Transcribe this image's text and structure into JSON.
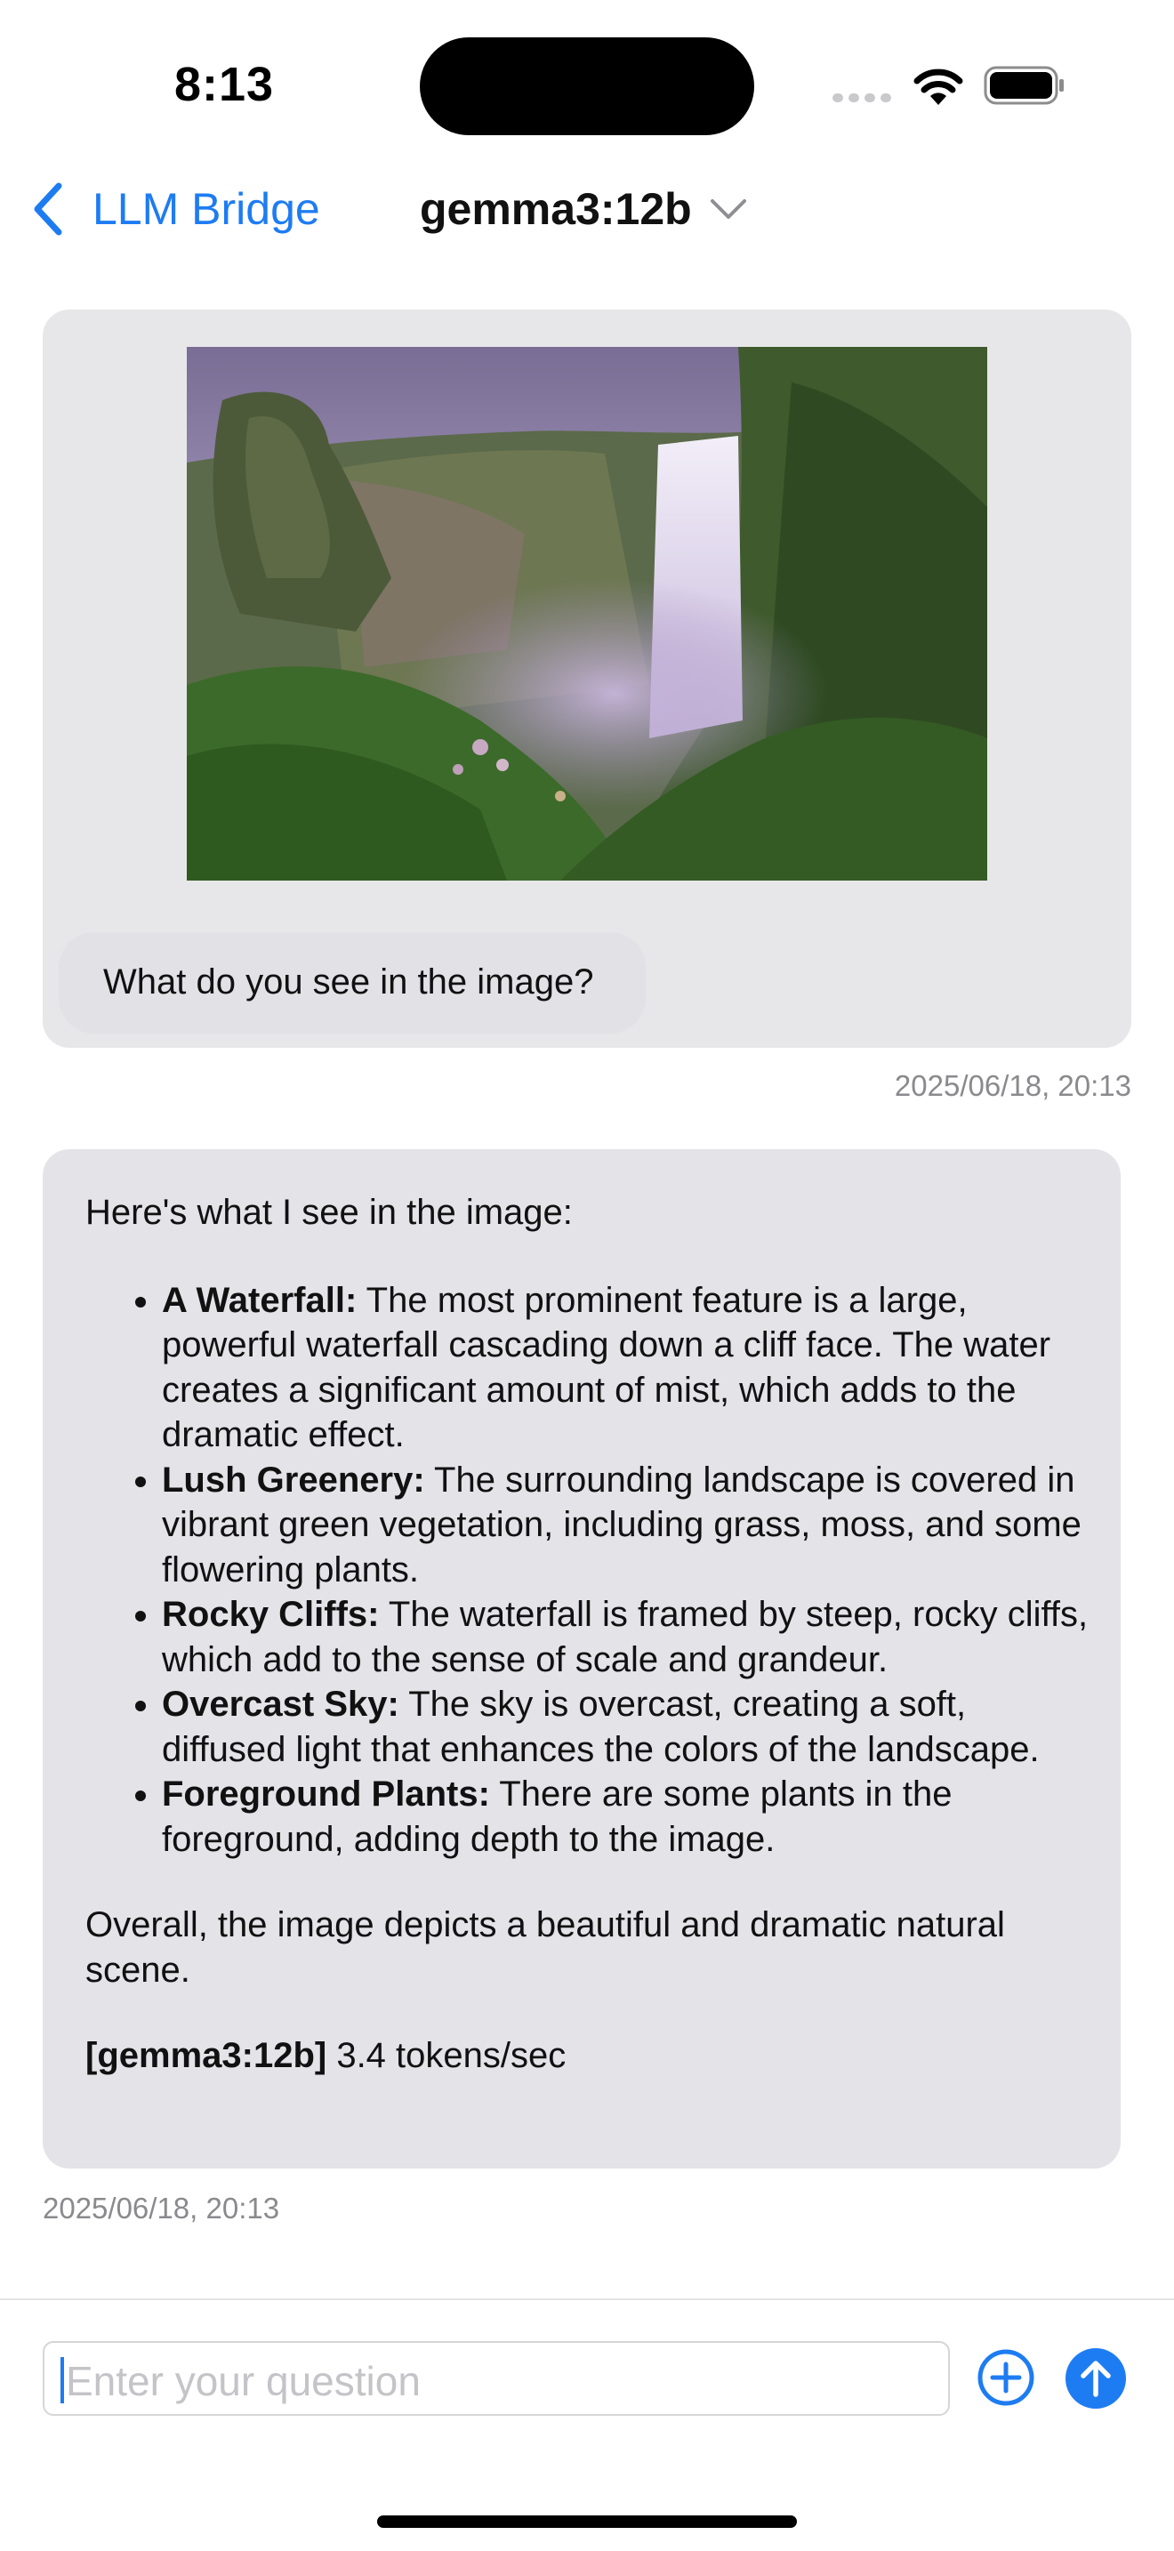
{
  "status_bar": {
    "time": "8:13"
  },
  "nav": {
    "back_label": "LLM Bridge",
    "model_title": "gemma3:12b",
    "back_icon": "chevron-left-icon",
    "model_menu_icon": "chevron-down-icon"
  },
  "conversation": {
    "user_message": {
      "image": "waterfall landscape photo",
      "text": "What do you see in the image?",
      "timestamp": "2025/06/18, 20:13"
    },
    "assistant_message": {
      "intro": "Here's what I see in the image:",
      "bullets": [
        {
          "title": "A Waterfall:",
          "text": " The most prominent feature is a large, powerful waterfall cascading down a cliff face. The water creates a significant amount of mist, which adds to the dramatic effect."
        },
        {
          "title": "Lush Greenery:",
          "text": " The surrounding landscape is covered in vibrant green vegetation, including grass, moss, and some flowering plants."
        },
        {
          "title": "Rocky Cliffs:",
          "text": " The waterfall is framed by steep, rocky cliffs, which add to the sense of scale and grandeur."
        },
        {
          "title": "Overcast Sky:",
          "text": " The sky is overcast, creating a soft, diffused light that enhances the colors of the landscape."
        },
        {
          "title": "Foreground Plants:",
          "text": " There are some plants in the foreground, adding depth to the image."
        }
      ],
      "outro": "Overall, the image depicts a beautiful and dramatic natural scene.",
      "model_tag": "[gemma3:12b]",
      "speed": " 3.4 tokens/sec",
      "timestamp": "2025/06/18, 20:13"
    }
  },
  "input_bar": {
    "placeholder": "Enter your question",
    "add_icon": "plus-circle-icon",
    "send_icon": "arrow-up-circle-icon"
  },
  "colors": {
    "accent": "#1e7cf2",
    "bubble": "#e7e7e9",
    "timestamp": "#8a8a8e"
  }
}
